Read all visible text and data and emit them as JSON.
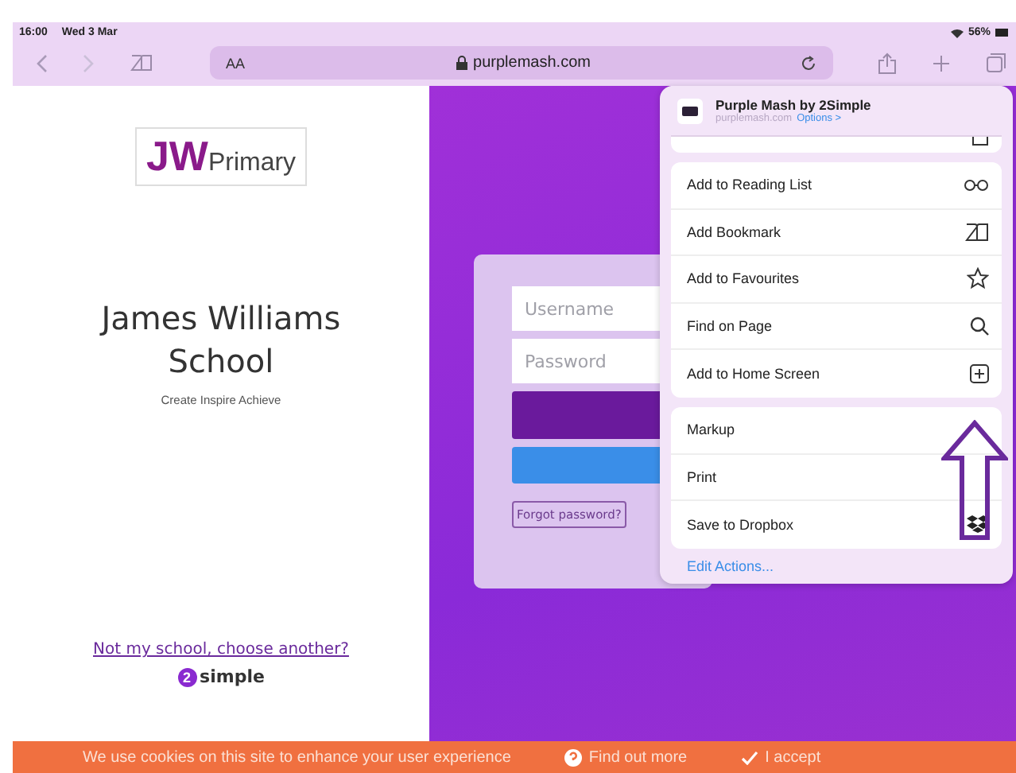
{
  "status_bar": {
    "time": "16:00",
    "date": "Wed 3 Mar",
    "battery": "56%"
  },
  "toolbar": {
    "text_size": "AA",
    "url": "purplemash.com"
  },
  "school": {
    "logo_initials": "JW",
    "logo_text": "Primary",
    "name": "James Williams School",
    "motto": "Create Inspire Achieve",
    "change_link": "Not my school, choose another?",
    "brand_mark": "2",
    "brand": "simple"
  },
  "login": {
    "username_placeholder": "Username",
    "password_placeholder": "Password",
    "forgot": "Forgot password?"
  },
  "share_sheet": {
    "app_title": "Purple Mash by 2Simple",
    "domain": "purplemash.com",
    "options": "Options >",
    "groups": [
      [
        {
          "label": "Add to Reading List",
          "kind": "glasses"
        },
        {
          "label": "Add Bookmark",
          "kind": "book"
        },
        {
          "label": "Add to Favourites",
          "kind": "star"
        },
        {
          "label": "Find on Page",
          "kind": "search"
        },
        {
          "label": "Add to Home Screen",
          "kind": "add"
        }
      ],
      [
        {
          "label": "Markup",
          "kind": "none"
        },
        {
          "label": "Print",
          "kind": "none"
        },
        {
          "label": "Save to Dropbox",
          "kind": "dropbox"
        }
      ]
    ],
    "edit_actions": "Edit Actions..."
  },
  "cookie_bar": {
    "message": "We use cookies on this site to enhance your user experience",
    "find_out_more": "Find out more",
    "accept": "I accept"
  }
}
